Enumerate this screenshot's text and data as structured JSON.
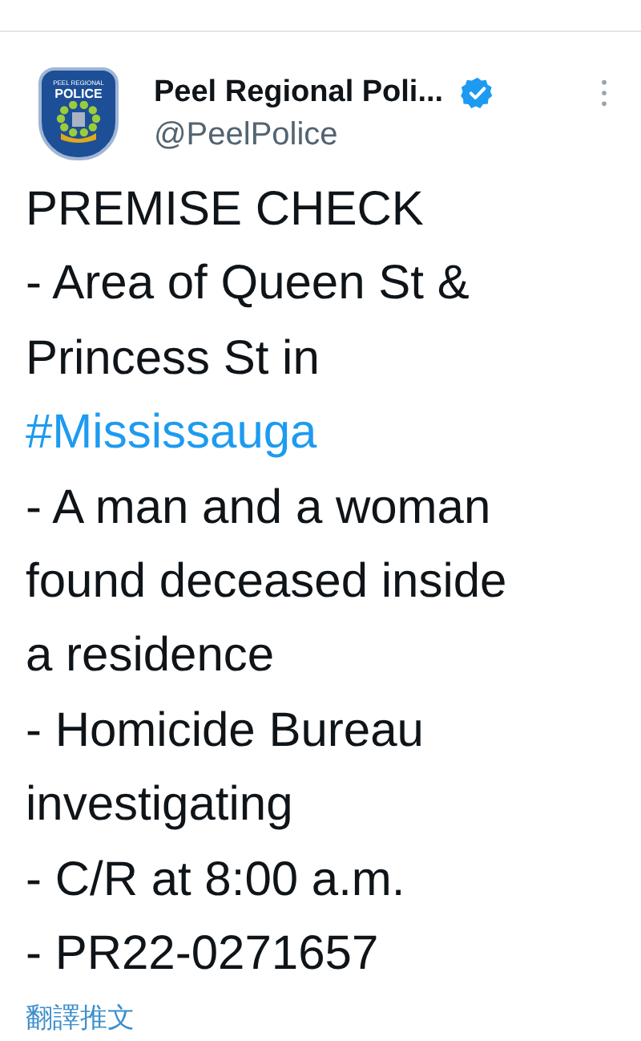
{
  "author": {
    "name": "Peel Regional Poli...",
    "handle": "@PeelPolice",
    "verified": true
  },
  "badge": {
    "top_text": "PEEL REGIONAL",
    "main_text": "POLICE"
  },
  "lines": [
    {
      "kind": "text",
      "text": "PREMISE CHECK"
    },
    {
      "kind": "text",
      "text": "- Area of Queen St &"
    },
    {
      "kind": "text",
      "text": "Princess St in"
    },
    {
      "kind": "hashtag",
      "text": "#Mississauga"
    },
    {
      "kind": "text",
      "text": "- A man and a woman"
    },
    {
      "kind": "text",
      "text": "found deceased inside"
    },
    {
      "kind": "text",
      "text": "a residence"
    },
    {
      "kind": "text",
      "text": "- Homicide Bureau"
    },
    {
      "kind": "text",
      "text": "investigating"
    },
    {
      "kind": "text",
      "text": "- C/R at 8:00 a.m."
    },
    {
      "kind": "text",
      "text": "- PR22-0271657"
    }
  ],
  "translate_link": "翻譯推文"
}
